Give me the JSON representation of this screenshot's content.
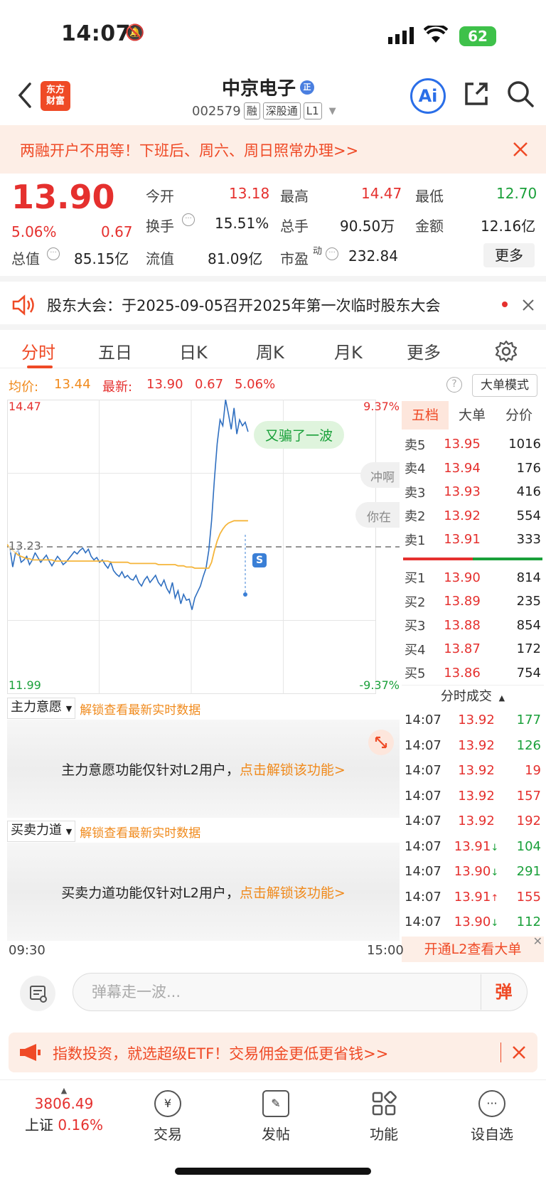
{
  "status_bar": {
    "time": "14:07",
    "battery": "62"
  },
  "header": {
    "logo_line1": "东方",
    "logo_line2": "财富",
    "stock_name": "中京电子",
    "stock_code": "002579",
    "tags": [
      "融",
      "深股通",
      "L1"
    ],
    "ai_label": "Ai"
  },
  "promo_banner": {
    "text": "两融开户不用等！下班后、周六、周日照常办理>>"
  },
  "quote": {
    "price": "13.90",
    "change_pct": "5.06%",
    "change": "0.67",
    "open_label": "今开",
    "open": "13.18",
    "high_label": "最高",
    "high": "14.47",
    "low_label": "最低",
    "low": "12.70",
    "turnover_label": "换手",
    "turnover": "15.51%",
    "volume_label": "总手",
    "volume": "90.50万",
    "amount_label": "金额",
    "amount": "12.16亿",
    "mktcap_label": "总值",
    "mktcap": "85.15亿",
    "float_label": "流值",
    "float": "81.09亿",
    "pe_label": "市盈",
    "pe_sup": "动",
    "pe": "232.84",
    "more_label": "更多"
  },
  "notice": {
    "text": "股东大会：于2025-09-05召开2025年第一次临时股东大会"
  },
  "tabs": [
    "分时",
    "五日",
    "日K",
    "周K",
    "月K",
    "更多"
  ],
  "info_line": {
    "avg_label": "均价:",
    "avg": "13.44",
    "latest_label": "最新:",
    "latest": "13.90",
    "change": "0.67",
    "change_pct": "5.06%",
    "big_order_mode": "大单模式"
  },
  "chart_data": {
    "type": "line",
    "y_top": "14.47",
    "y_bottom": "11.99",
    "pct_top": "9.37%",
    "pct_bottom": "-9.37%",
    "prev_close": "13.23",
    "x_start": "09:30",
    "x_end": "15:00",
    "callout": "又骗了一波",
    "danmu": [
      "冲啊",
      "你在"
    ],
    "marker": "S",
    "ylim": [
      11.99,
      14.47
    ],
    "series": [
      {
        "values": [
          13.25,
          13.22,
          13.06,
          13.18,
          13.2,
          13.1,
          13.12,
          13.15,
          13.08,
          13.12,
          13.18,
          13.14,
          13.1,
          13.13,
          13.16,
          13.11,
          13.07,
          13.11,
          13.15,
          13.12,
          13.08,
          13.1,
          13.13,
          13.16,
          13.19,
          13.17,
          13.2,
          13.22,
          13.18,
          13.21,
          13.15,
          13.12,
          13.14,
          13.1,
          13.12,
          13.08,
          13.05,
          13.1,
          13.03,
          13.0,
          12.98,
          13.02,
          12.97,
          12.99,
          12.96,
          12.95,
          12.99,
          12.93,
          12.9,
          12.95,
          12.98,
          12.93,
          12.96,
          12.99,
          12.93,
          12.9,
          12.95,
          12.88,
          12.84,
          12.93,
          12.8,
          12.86,
          12.75,
          12.83,
          12.78,
          12.79,
          12.7,
          12.8,
          12.85,
          12.9,
          12.98,
          13.05,
          13.2,
          13.45,
          13.8,
          14.1,
          14.3,
          14.25,
          14.47,
          14.35,
          14.22,
          14.4,
          14.18,
          14.3,
          14.25,
          14.28,
          14.2
        ]
      },
      {
        "values": [
          13.25,
          13.22,
          13.2,
          13.18,
          13.16,
          13.15,
          13.14,
          13.13,
          13.13,
          13.12,
          13.12,
          13.12,
          13.12,
          13.12,
          13.12,
          13.12,
          13.12,
          13.11,
          13.11,
          13.11,
          13.11,
          13.11,
          13.11,
          13.11,
          13.11,
          13.11,
          13.11,
          13.11,
          13.11,
          13.11,
          13.11,
          13.11,
          13.11,
          13.11,
          13.11,
          13.11,
          13.11,
          13.1,
          13.1,
          13.1,
          13.1,
          13.1,
          13.1,
          13.1,
          13.09,
          13.09,
          13.09,
          13.09,
          13.09,
          13.09,
          13.09,
          13.09,
          13.09,
          13.09,
          13.08,
          13.08,
          13.08,
          13.08,
          13.08,
          13.08,
          13.08,
          13.07,
          13.07,
          13.07,
          13.06,
          13.06,
          13.06,
          13.05,
          13.05,
          13.05,
          13.05,
          13.05,
          13.05,
          13.1,
          13.2,
          13.28,
          13.34,
          13.38,
          13.41,
          13.43,
          13.44,
          13.45,
          13.45,
          13.45,
          13.45,
          13.45,
          13.45
        ]
      }
    ]
  },
  "order_book": {
    "tabs": [
      "五档",
      "大单",
      "分价"
    ],
    "sells": [
      {
        "label": "卖5",
        "price": "13.95",
        "vol": "1016"
      },
      {
        "label": "卖4",
        "price": "13.94",
        "vol": "176"
      },
      {
        "label": "卖3",
        "price": "13.93",
        "vol": "416"
      },
      {
        "label": "卖2",
        "price": "13.92",
        "vol": "554"
      },
      {
        "label": "卖1",
        "price": "13.91",
        "vol": "333"
      }
    ],
    "buys": [
      {
        "label": "买1",
        "price": "13.90",
        "vol": "814"
      },
      {
        "label": "买2",
        "price": "13.89",
        "vol": "235"
      },
      {
        "label": "买3",
        "price": "13.88",
        "vol": "854"
      },
      {
        "label": "买4",
        "price": "13.87",
        "vol": "172"
      },
      {
        "label": "买5",
        "price": "13.86",
        "vol": "754"
      }
    ]
  },
  "trades": {
    "title": "分时成交",
    "rows": [
      {
        "time": "14:07",
        "price": "13.92",
        "vol": "177",
        "dir": "",
        "color": "#1aa03a"
      },
      {
        "time": "14:07",
        "price": "13.92",
        "vol": "126",
        "dir": "",
        "color": "#1aa03a"
      },
      {
        "time": "14:07",
        "price": "13.92",
        "vol": "19",
        "dir": "",
        "color": "#e5302e"
      },
      {
        "time": "14:07",
        "price": "13.92",
        "vol": "157",
        "dir": "",
        "color": "#e5302e"
      },
      {
        "time": "14:07",
        "price": "13.92",
        "vol": "192",
        "dir": "",
        "color": "#e5302e"
      },
      {
        "time": "14:07",
        "price": "13.91",
        "vol": "104",
        "dir": "↓",
        "color": "#1aa03a"
      },
      {
        "time": "14:07",
        "price": "13.90",
        "vol": "291",
        "dir": "↓",
        "color": "#1aa03a"
      },
      {
        "time": "14:07",
        "price": "13.91",
        "vol": "155",
        "dir": "↑",
        "color": "#e5302e"
      },
      {
        "time": "14:07",
        "price": "13.90",
        "vol": "112",
        "dir": "↓",
        "color": "#1aa03a"
      }
    ],
    "l2_banner": "开通L2查看大单"
  },
  "main_intent": {
    "dropdown": "主力意愿",
    "unlock_hint": "解锁查看最新实时数据",
    "locked_text": "主力意愿功能仅针对L2用户，",
    "unlock_link": "点击解锁该功能>"
  },
  "buy_sell_force": {
    "dropdown": "买卖力道",
    "unlock_hint": "解锁查看最新实时数据",
    "locked_text": "买卖力道功能仅针对L2用户，",
    "unlock_link": "点击解锁该功能>"
  },
  "danmu_bar": {
    "placeholder": "弹幕走一波...",
    "send_label": "弹"
  },
  "etf_banner": {
    "text": "指数投资，就选超级ETF！交易佣金更低更省钱>>"
  },
  "bottom_nav": {
    "index_value": "3806.49",
    "index_name": "上证",
    "index_change": "0.16%",
    "items": [
      "交易",
      "发帖",
      "功能",
      "设自选"
    ]
  },
  "colors": {
    "up": "#e5302e",
    "down": "#1aa03a",
    "brand": "#ef4a26",
    "price_line": "#2f6fc0",
    "avg_line": "#f5b53a"
  }
}
